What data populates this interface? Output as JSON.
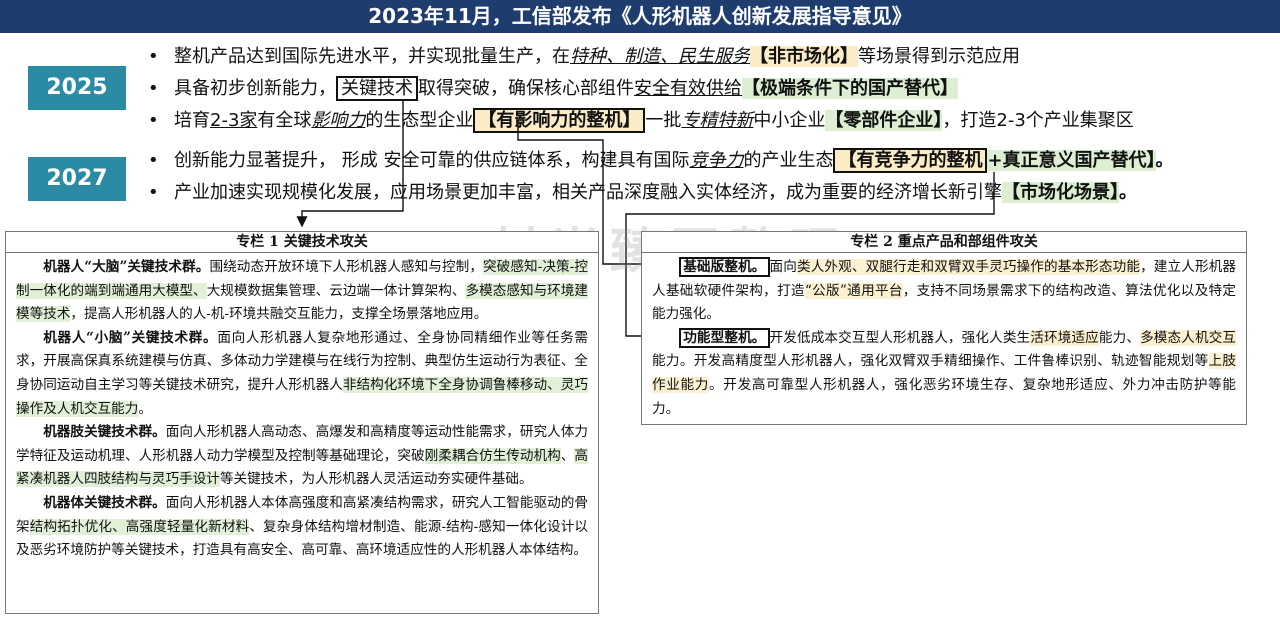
{
  "banner_title": "2023年11月，工信部发布《人形机器人创新发展指导意见》",
  "years": {
    "y2025": "2025",
    "y2027": "2027"
  },
  "bullets_2025": [
    {
      "a": "整机产品达到国际先进水平，并实现批量生产，在",
      "b": "特种、制造、民生服务",
      "c": "【非市场化】",
      "d": "等场景得到示范应用"
    },
    {
      "a": "具备初步创新能力，",
      "b": "关键技术",
      "c": "取得突破，确保核心部组件",
      "d": "安全有效供给",
      "e": "【极端条件下的国产替代】"
    },
    {
      "a": "培育",
      "b": "2-3家",
      "c": "有全球",
      "d": "影响力",
      "e": "的生态型企业",
      "f": "【有影响力的整机】",
      "g": "一批",
      "h": "专精特新",
      "i": "中小企业",
      "j": "【零部件企业】",
      "k": "，打造2-3个产业集聚区"
    }
  ],
  "bullets_2027": [
    {
      "a": "创新能力显著提升， 形成 安全可靠的供应链体系，构建具有国际",
      "b": "竞争力",
      "c": "的产业生态",
      "d": "【有竞争力的整机",
      "e": "+真正意义国产替代】",
      "f": "。"
    },
    {
      "a": "产业加速实现规模化发展，应用场景更加丰富，相关产品深度融入实体经济，成为重要的经济增长新引擎",
      "b": "【市场化场景】",
      "c": "。"
    }
  ],
  "panel1": {
    "title": "专栏 1  关键技术攻关",
    "p1": {
      "h": "机器人“大脑”关键技术群。",
      "t1": "围绕动态开放环境下人形机器人感知与控制，",
      "g1": "突破感知-决策-控制一体化的端到端通用大模型、",
      "t2": "大规模数据集管理、云边端一体计算架构、",
      "g2": "多模态感知与环境建模等技术",
      "t3": "，提高人形机器人的人-机-环境共融交互能力，支撑全场景落地应用。"
    },
    "p2": {
      "h": "机器人“小脑”关键技术群。",
      "t1": "面向人形机器人复杂地形通过、全身协同精细作业等任务需求，开展高保真系统建模与仿真、多体动力学建模与在线行为控制、典型仿生运动行为表征、全身协同运动自主学习等关键技术研究，提升人形机器人",
      "g1": "非结构化环境下全身协调鲁棒移动、灵巧操作及人机交互能力",
      "t2": "。"
    },
    "p3": {
      "h": "机器肢关键技术群。",
      "t1": "面向人形机器人高动态、高爆发和高精度等运动性能需求，研究人体力学特征及运动机理、人形机器人动力学模型及控制等基础理论，突破",
      "g1": "刚柔耦合仿生传动机构",
      "t2": "、",
      "g2": "高紧凑机器人四肢结构与灵巧手设计",
      "t3": "等关键技术，为人形机器人灵活运动夯实硬件基础。"
    },
    "p4": {
      "h": "机器体关键技术群。",
      "t1": "面向人形机器人本体高强度和高紧凑结构需求，研究人工智能驱动的骨架",
      "g1": "结构拓扑优化、高强度轻量化新材料",
      "t2": "、复杂身体结构增材制造、能源-结构-感知一体化设计以及恶劣环境防护等关键技术，打造具有高安全、高可靠、高环境适应性的人形机器人本体结构。"
    }
  },
  "panel2": {
    "title": "专栏 2  重点产品和部组件攻关",
    "p1": {
      "h": "基础版整机。",
      "t1": "面向",
      "y1": "类人外观、双腿行走和双臂双手灵巧操作的基本形态功能",
      "t2": "，建立人形机器人基础软硬件架构，打造",
      "y2": "“公版”通用平台",
      "t3": "，支持不同场景需求下的结构改造、算法优化以及特定能力强化。"
    },
    "p2": {
      "h": "功能型整机。",
      "t1": "开发低成本交互型人形机器人，强化人类生",
      "y1": "活环境适应",
      "t2": "能力、",
      "y2": "多模态人机交互",
      "t3": "能力。开发高精度型人形机器人，强化双臂双手精细操作、工件鲁棒识别、轨迹智能规划等",
      "y3": "上肢作业能力",
      "t4": "。开发高可靠型人形机器人，强化恶劣环境生存、复杂地形适应、外力冲击防护等能力。"
    }
  },
  "watermark": "一村尚臻国整理"
}
